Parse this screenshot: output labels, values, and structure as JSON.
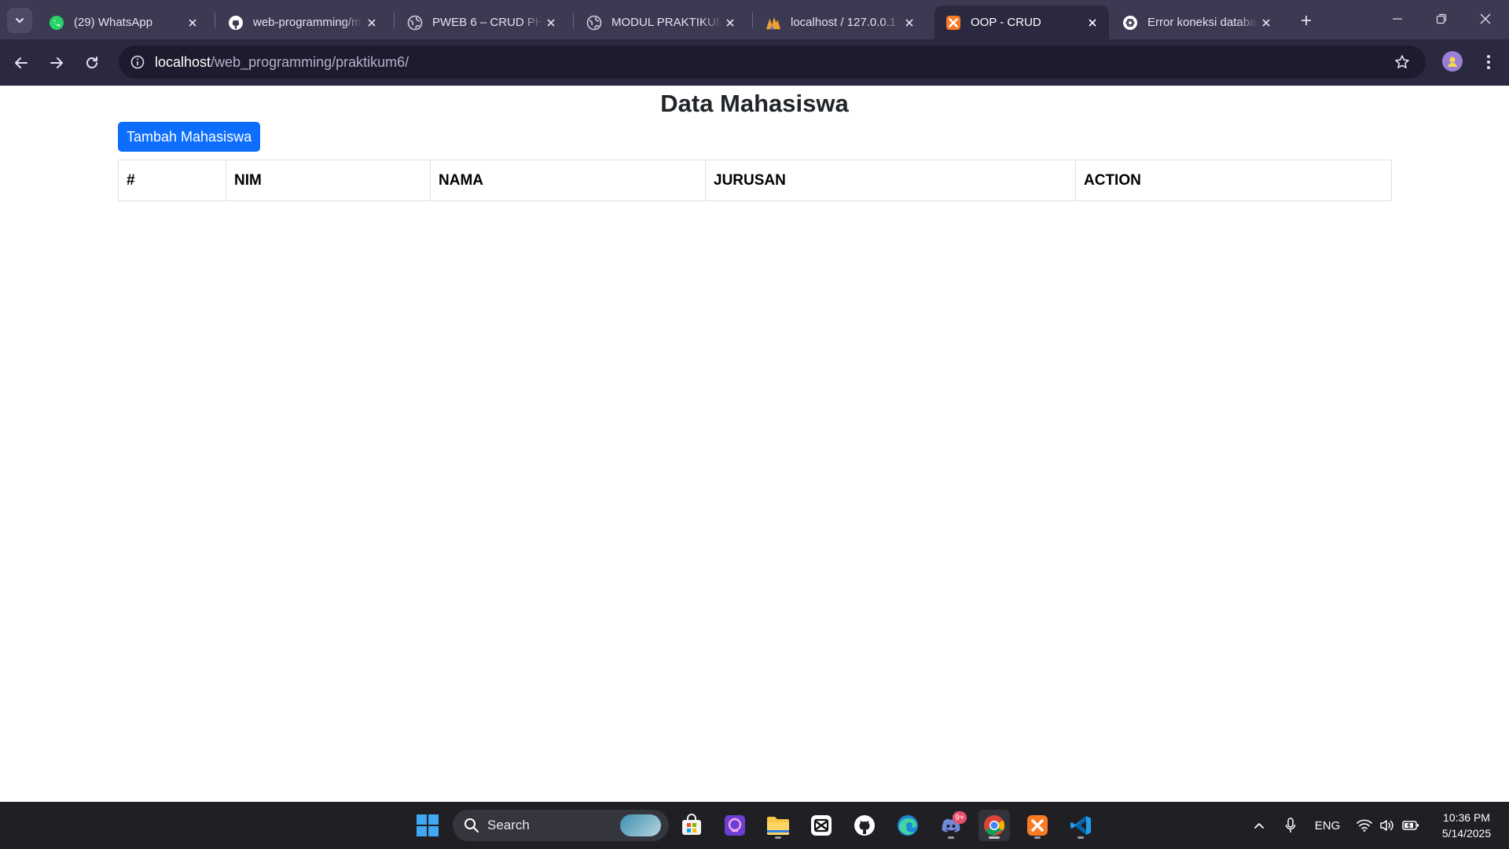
{
  "browser": {
    "tabs": [
      {
        "title": "(29) WhatsApp",
        "icon": "whatsapp-icon",
        "active": false
      },
      {
        "title": "web-programming/m",
        "icon": "github-icon",
        "active": false
      },
      {
        "title": "PWEB 6 – CRUD PHP",
        "icon": "globe-icon",
        "active": false
      },
      {
        "title": "MODUL PRAKTIKUM",
        "icon": "globe-icon",
        "active": false
      },
      {
        "title": "localhost / 127.0.0.1 /",
        "icon": "phpmyadmin-icon",
        "active": false
      },
      {
        "title": "OOP - CRUD",
        "icon": "xampp-icon",
        "active": true
      },
      {
        "title": "Error koneksi databa",
        "icon": "chatgpt-icon",
        "active": false
      }
    ],
    "address": {
      "host": "localhost",
      "path": "/web_programming/praktikum6/"
    }
  },
  "page": {
    "title": "Data Mahasiswa",
    "add_button": "Tambah Mahasiswa",
    "table": {
      "headers": [
        "#",
        "NIM",
        "NAMA",
        "JURUSAN",
        "ACTION"
      ]
    }
  },
  "taskbar": {
    "search_label": "Search",
    "language": "ENG",
    "time": "10:36 PM",
    "date": "5/14/2025",
    "discord_badge": "9+"
  },
  "colors": {
    "primary_button": "#0d6efd",
    "chrome_tabstrip": "#3c3a52",
    "chrome_toolbar": "#2b2940",
    "taskbar": "#1f1f24"
  }
}
